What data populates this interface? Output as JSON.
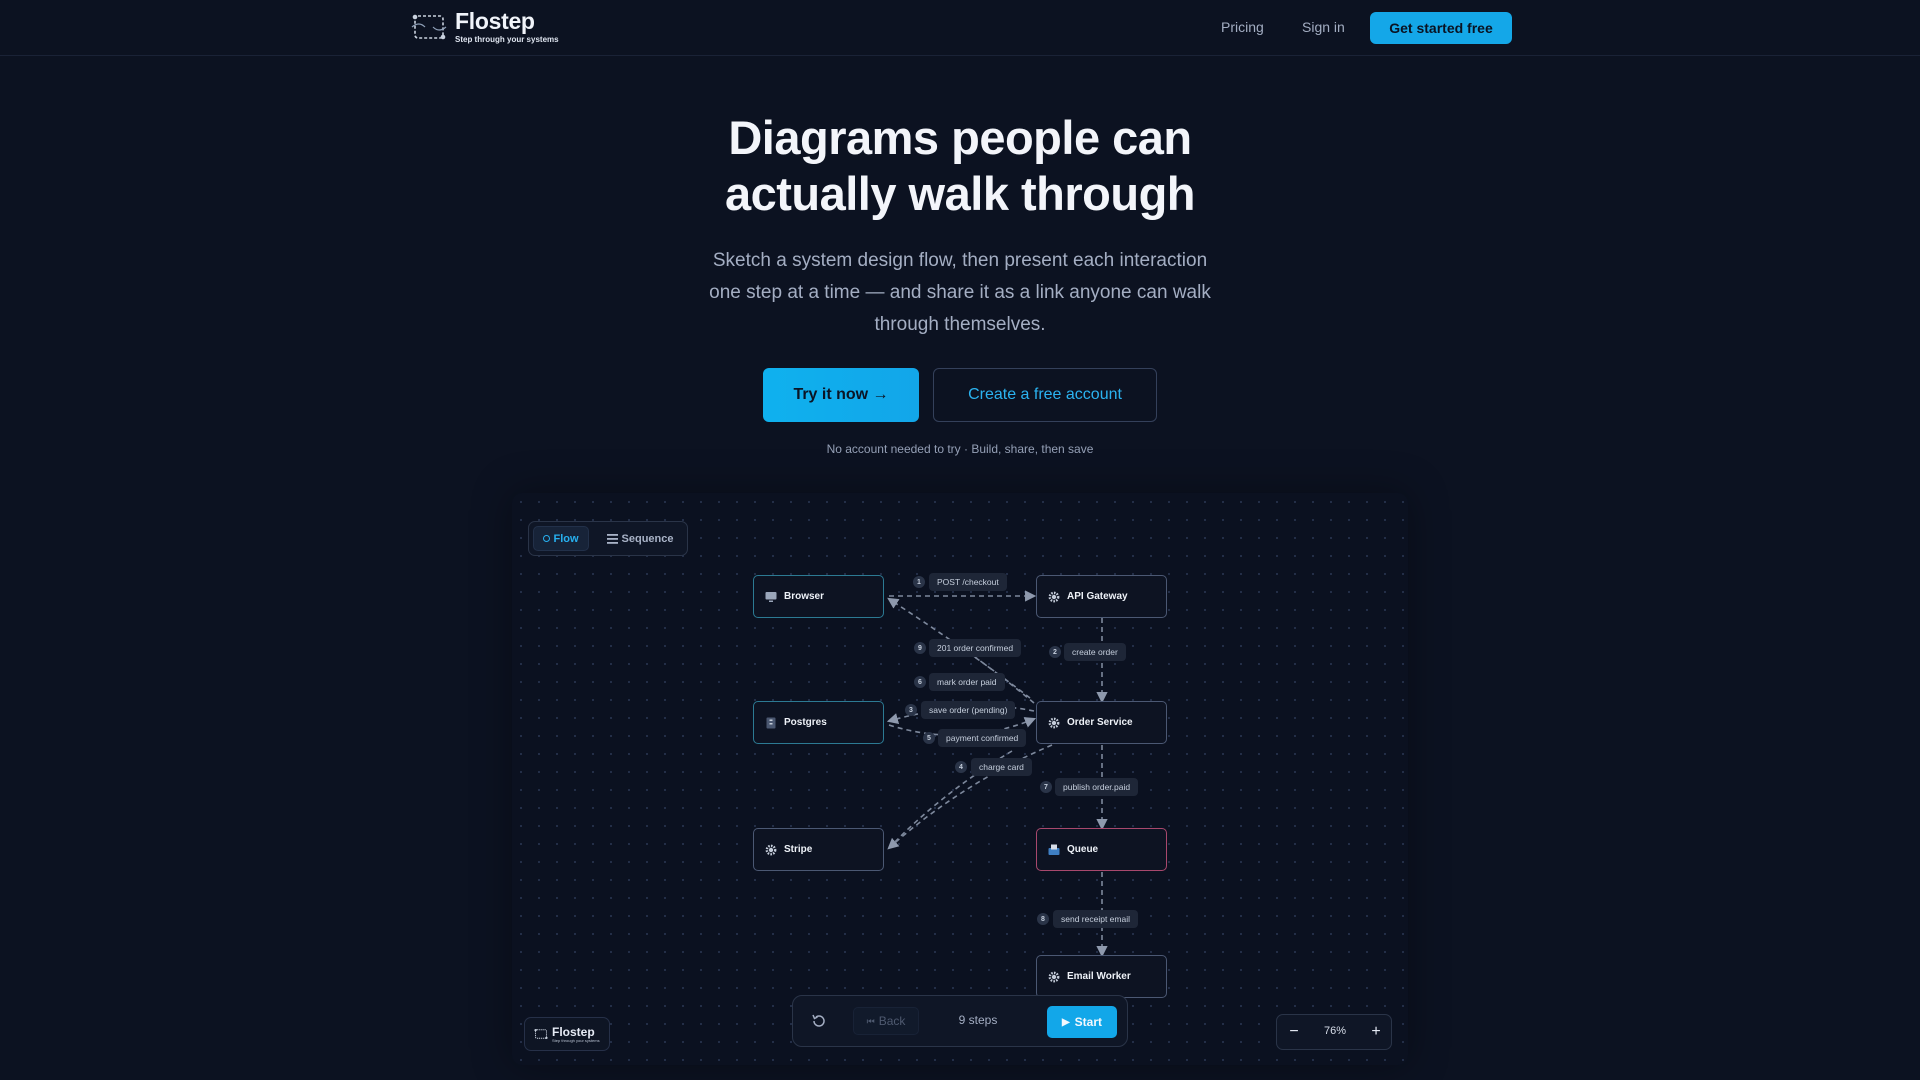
{
  "nav": {
    "brand_name": "Flostep",
    "brand_tagline": "Step through your systems",
    "pricing": "Pricing",
    "sign_in": "Sign in",
    "get_started": "Get started free"
  },
  "hero": {
    "title_line1": "Diagrams people can",
    "title_line2": "actually walk through",
    "subtitle_line1": "Sketch a system design flow, then present each interaction",
    "subtitle_line2": "one step at a time — and share it as a link anyone can walk",
    "subtitle_line3": "through themselves.",
    "try_button": "Try it now →",
    "create_button": "Create a free account",
    "note": "No account needed to try · Build, share, then save"
  },
  "diagram": {
    "modes": {
      "flow": "Flow",
      "sequence": "Sequence",
      "active": "flow"
    },
    "nodes": {
      "browser": "Browser",
      "api_gateway": "API Gateway",
      "postgres": "Postgres",
      "order_service": "Order Service",
      "stripe": "Stripe",
      "queue": "Queue",
      "email_worker": "Email Worker"
    },
    "edges": [
      {
        "step": "1",
        "label": "POST /checkout"
      },
      {
        "step": "2",
        "label": "create order"
      },
      {
        "step": "3",
        "label": "save order (pending)"
      },
      {
        "step": "4",
        "label": "charge card"
      },
      {
        "step": "5",
        "label": "payment confirmed"
      },
      {
        "step": "6",
        "label": "mark order paid"
      },
      {
        "step": "7",
        "label": "publish order.paid"
      },
      {
        "step": "8",
        "label": "send receipt email"
      },
      {
        "step": "9",
        "label": "201 order confirmed"
      }
    ],
    "mini_brand_name": "Flostep",
    "mini_brand_tag": "Step through your systems",
    "player": {
      "back": "Back",
      "steps": "9 steps",
      "start": "Start"
    },
    "zoom": {
      "minus": "−",
      "value": "76%",
      "plus": "+"
    }
  },
  "colors": {
    "accent": "#14a7e8",
    "background": "#0c1221",
    "node_border": "#4b5873",
    "node_teal": "#2c7a93",
    "node_pink": "#a8486d"
  }
}
